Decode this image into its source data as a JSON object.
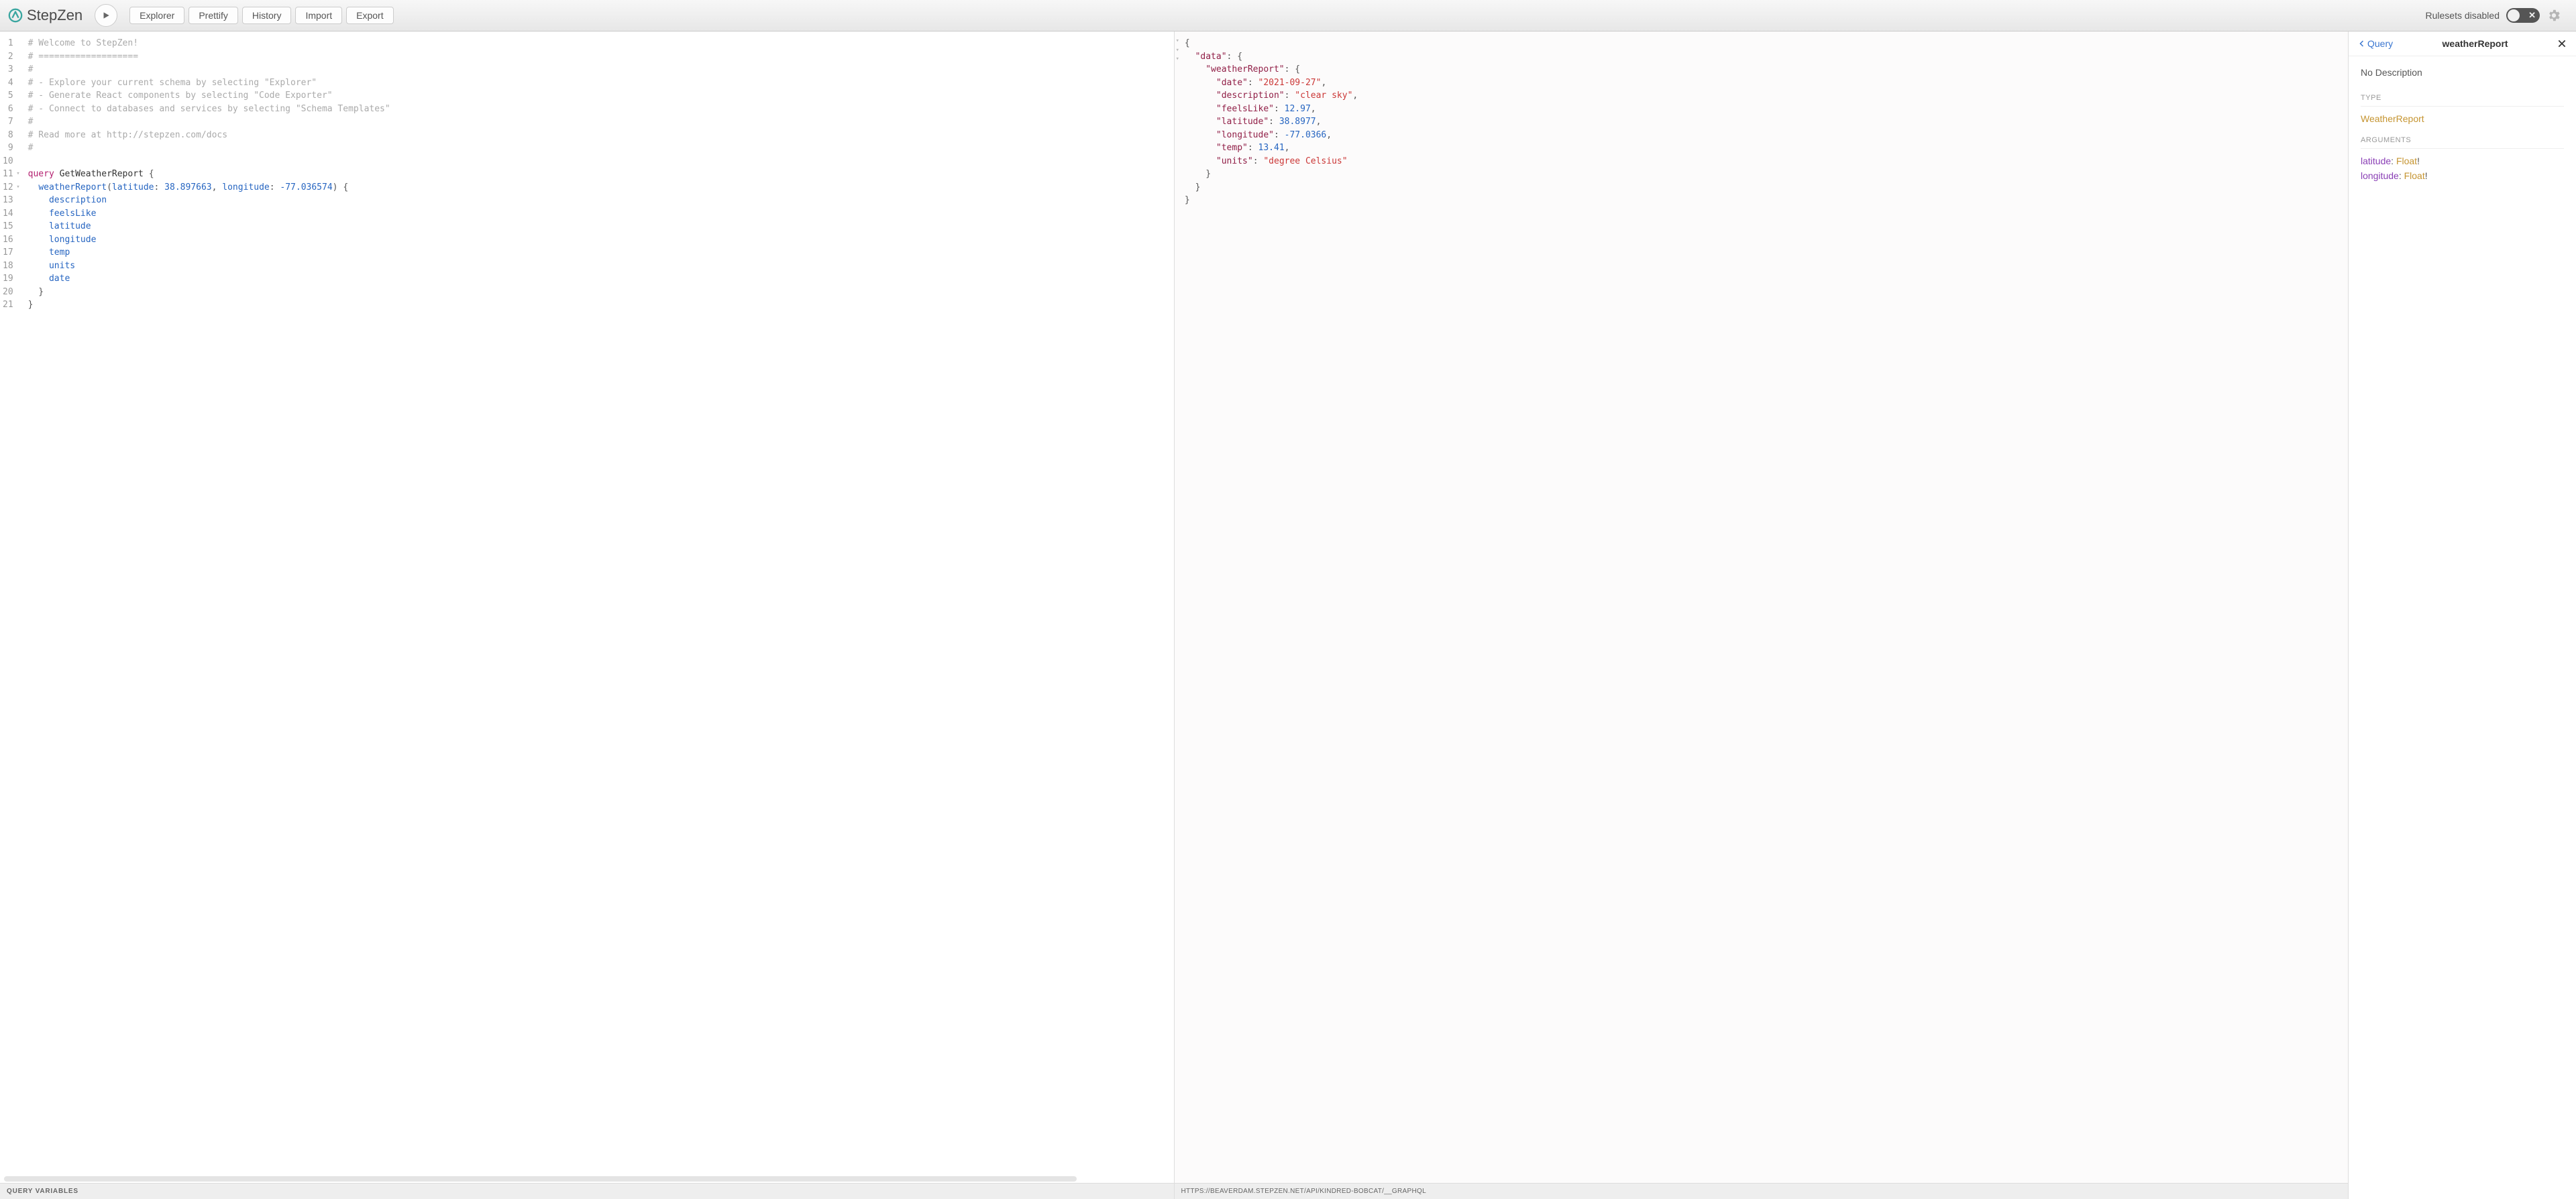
{
  "brand": "StepZen",
  "toolbar": {
    "buttons": {
      "explorer": "Explorer",
      "prettify": "Prettify",
      "history": "History",
      "import": "Import",
      "export": "Export"
    },
    "rulesets_label": "Rulesets disabled"
  },
  "editor": {
    "lines": [
      {
        "n": "1",
        "fold": "",
        "type": "comment",
        "text": "# Welcome to StepZen!"
      },
      {
        "n": "2",
        "fold": "",
        "type": "comment",
        "text": "# ==================="
      },
      {
        "n": "3",
        "fold": "",
        "type": "comment",
        "text": "#"
      },
      {
        "n": "4",
        "fold": "",
        "type": "comment",
        "text": "# - Explore your current schema by selecting \"Explorer\""
      },
      {
        "n": "5",
        "fold": "",
        "type": "comment",
        "text": "# - Generate React components by selecting \"Code Exporter\""
      },
      {
        "n": "6",
        "fold": "",
        "type": "comment",
        "text": "# - Connect to databases and services by selecting \"Schema Templates\""
      },
      {
        "n": "7",
        "fold": "",
        "type": "comment",
        "text": "#"
      },
      {
        "n": "8",
        "fold": "",
        "type": "comment",
        "text": "# Read more at http://stepzen.com/docs"
      },
      {
        "n": "9",
        "fold": "",
        "type": "comment",
        "text": "#"
      },
      {
        "n": "10",
        "fold": "",
        "type": "blank",
        "text": ""
      },
      {
        "n": "11",
        "fold": "▾",
        "type": "queryhead"
      },
      {
        "n": "12",
        "fold": "▾",
        "type": "callhead"
      },
      {
        "n": "13",
        "fold": "",
        "type": "field",
        "text": "description"
      },
      {
        "n": "14",
        "fold": "",
        "type": "field",
        "text": "feelsLike"
      },
      {
        "n": "15",
        "fold": "",
        "type": "field",
        "text": "latitude"
      },
      {
        "n": "16",
        "fold": "",
        "type": "field",
        "text": "longitude"
      },
      {
        "n": "17",
        "fold": "",
        "type": "field",
        "text": "temp"
      },
      {
        "n": "18",
        "fold": "",
        "type": "field",
        "text": "units"
      },
      {
        "n": "19",
        "fold": "",
        "type": "field",
        "text": "date"
      },
      {
        "n": "20",
        "fold": "",
        "type": "close",
        "text": "  }"
      },
      {
        "n": "21",
        "fold": "",
        "type": "close",
        "text": "}"
      }
    ],
    "queryKeyword": "query",
    "queryName": "GetWeatherReport",
    "callName": "weatherReport",
    "args": {
      "lat_key": "latitude",
      "lat_val": "38.897663",
      "lon_key": "longitude",
      "lon_val": "-77.036574"
    },
    "variables_label": "Query Variables"
  },
  "results": {
    "data": {
      "data_key": "data",
      "report_key": "weatherReport",
      "entries": [
        {
          "key": "date",
          "value": "\"2021-09-27\"",
          "isString": true
        },
        {
          "key": "description",
          "value": "\"clear sky\"",
          "isString": true
        },
        {
          "key": "feelsLike",
          "value": "12.97",
          "isString": false
        },
        {
          "key": "latitude",
          "value": "38.8977",
          "isString": false
        },
        {
          "key": "longitude",
          "value": "-77.0366",
          "isString": false
        },
        {
          "key": "temp",
          "value": "13.41",
          "isString": false
        },
        {
          "key": "units",
          "value": "\"degree Celsius\"",
          "isString": false,
          "isLast": true,
          "actuallyString": true
        }
      ]
    },
    "endpoint": "https://beaverdam.stepzen.net/api/kindred-bobcat/__graphql"
  },
  "docs": {
    "back_label": "Query",
    "title": "weatherReport",
    "description": "No Description",
    "type_heading": "TYPE",
    "type_name": "WeatherReport",
    "arguments_heading": "ARGUMENTS",
    "args": [
      {
        "name": "latitude",
        "type": "Float",
        "required": "!"
      },
      {
        "name": "longitude",
        "type": "Float",
        "required": "!"
      }
    ]
  }
}
